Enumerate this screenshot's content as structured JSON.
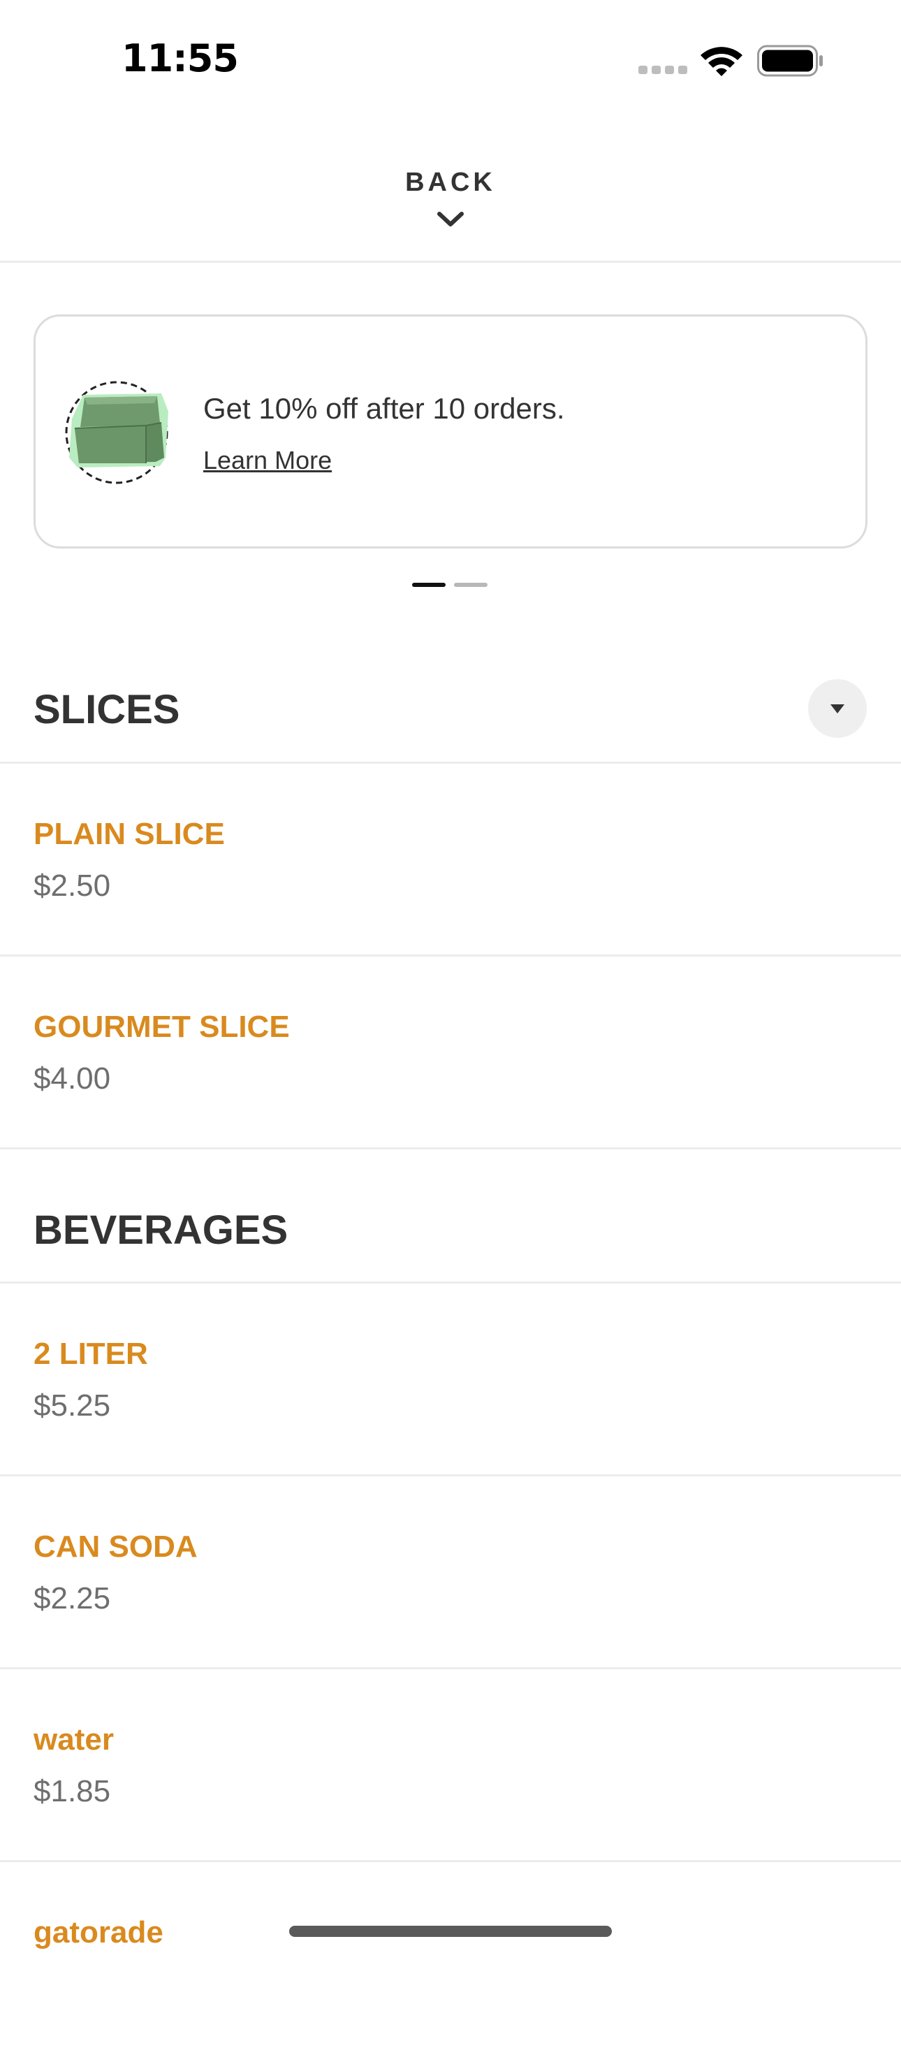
{
  "status_bar": {
    "time": "11:55",
    "wifi_icon": "wifi-icon",
    "battery_icon": "battery-icon",
    "cellular_icon": "cellular-dots-icon"
  },
  "header": {
    "back_label": "BACK",
    "back_icon": "chevron-down-icon"
  },
  "promo": {
    "text": "Get 10% off after 10 orders.",
    "link_label": "Learn More",
    "illustration": "pizza-box-icon",
    "pager": {
      "count": 2,
      "active_index": 0
    }
  },
  "menu": {
    "sections": [
      {
        "title": "SLICES",
        "collapse_icon": "caret-down-icon",
        "items": [
          {
            "name": "PLAIN SLICE",
            "price": "$2.50"
          },
          {
            "name": "GOURMET SLICE",
            "price": "$4.00"
          }
        ]
      },
      {
        "title": "BEVERAGES",
        "items": [
          {
            "name": "2 LITER",
            "price": "$5.25"
          },
          {
            "name": "CAN SODA",
            "price": "$2.25"
          },
          {
            "name": "water",
            "price": "$1.85"
          },
          {
            "name": "gatorade",
            "price": ""
          }
        ]
      }
    ]
  },
  "colors": {
    "item_name": "#d98a1e",
    "price": "#6e6e6e",
    "text": "#333333",
    "divider": "#ececec",
    "promo_box_green": "#8fbf8a"
  }
}
